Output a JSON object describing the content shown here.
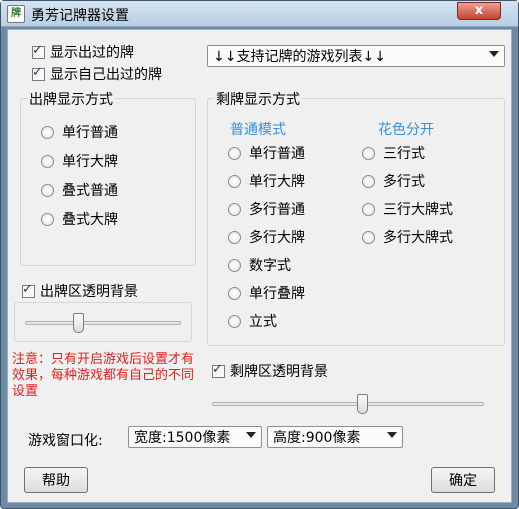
{
  "window": {
    "title": "勇芳记牌器设置",
    "app_icon": "牌",
    "close_label": "x"
  },
  "options": {
    "show_played": "显示出过的牌",
    "show_self_played": "显示自己出过的牌",
    "game_list": "↓↓支持记牌的游戏列表↓↓"
  },
  "out_display": {
    "title": "出牌显示方式",
    "items": [
      "单行普通",
      "单行大牌",
      "叠式普通",
      "叠式大牌"
    ],
    "transparent_label": "出牌区透明背景"
  },
  "left_display": {
    "title": "剩牌显示方式",
    "normal_heading": "普通模式",
    "suit_heading": "花色分开",
    "normal_items": [
      "单行普通",
      "单行大牌",
      "多行普通",
      "多行大牌",
      "数字式",
      "单行叠牌",
      "立式"
    ],
    "suit_items": [
      "三行式",
      "多行式",
      "三行大牌式",
      "多行大牌式"
    ],
    "transparent_label": "剩牌区透明背景"
  },
  "note": "注意：只有开启游戏后设置才有效果，每种游戏都有自己的不同设置",
  "windowize": {
    "label": "游戏窗口化:",
    "width": "宽度:1500像素",
    "height": "高度:900像素"
  },
  "buttons": {
    "help": "帮助",
    "ok": "确定"
  },
  "colors": {
    "accent": "#3b8fd6",
    "warning": "#e02020"
  }
}
